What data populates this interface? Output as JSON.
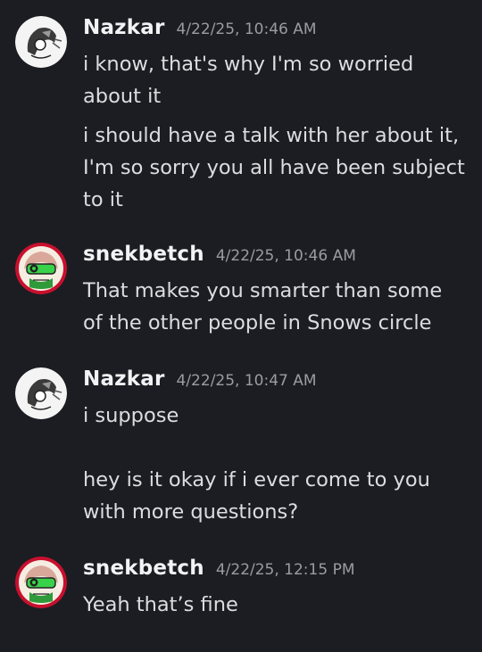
{
  "messages": [
    {
      "author": "Nazkar",
      "avatar_icon": "nazkar-avatar-icon",
      "timestamp": "4/22/25, 10:46 AM",
      "paragraphs": [
        [
          "i know, that's why I'm so worried",
          "about it"
        ],
        [
          "i should have a talk with her about it,",
          "I'm so sorry you all have been subject",
          "to it"
        ]
      ]
    },
    {
      "author": "snekbetch",
      "avatar_icon": "snekbetch-avatar-icon",
      "timestamp": "4/22/25, 10:46 AM",
      "paragraphs": [
        [
          "That makes you smarter than some",
          "of the other people in Snows circle"
        ]
      ]
    },
    {
      "author": "Nazkar",
      "avatar_icon": "nazkar-avatar-icon",
      "timestamp": "4/22/25, 10:47 AM",
      "paragraphs": [
        [
          "i suppose"
        ],
        [
          "hey is it okay if i ever come to you",
          "with more questions?"
        ]
      ]
    },
    {
      "author": "snekbetch",
      "avatar_icon": "snekbetch-avatar-icon",
      "timestamp": "4/22/25, 12:15 PM",
      "paragraphs": [
        [
          "Yeah that’s fine"
        ]
      ]
    }
  ],
  "colors": {
    "background": "#1c1d22",
    "username": "#f2f3f5",
    "timestamp": "#9a9ca3",
    "message_text": "#dcdde1",
    "snekbetch_avatar_ring": "#c8102e",
    "snekbetch_visor": "#3ad14a"
  }
}
